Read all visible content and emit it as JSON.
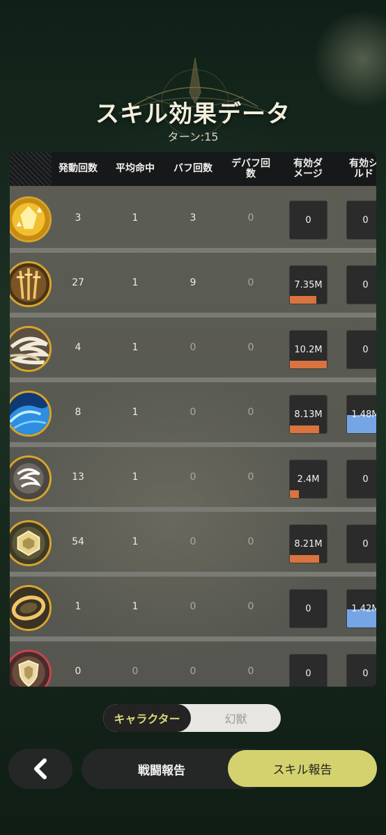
{
  "header": {
    "title": "スキル効果データ",
    "turn": "ターン:15"
  },
  "table": {
    "columns": [
      "発動回数",
      "平均命中",
      "バフ回数",
      "デバフ回\n数",
      "有効ダ\nメージ",
      "有効シ\nルド"
    ],
    "rows": [
      {
        "icon": "glowing-crystal-icon",
        "activations": "3",
        "avg_hit": "1",
        "buffs": "3",
        "debuffs": "0",
        "damage": "0",
        "damage_fill": 0,
        "shield": "0",
        "shield_fill": 0
      },
      {
        "icon": "triple-sword-icon",
        "activations": "27",
        "avg_hit": "1",
        "buffs": "9",
        "debuffs": "0",
        "damage": "7.35M",
        "damage_fill": 0.72,
        "shield": "0",
        "shield_fill": 0
      },
      {
        "icon": "whirlwind-icon",
        "activations": "4",
        "avg_hit": "1",
        "buffs": "0",
        "debuffs": "0",
        "damage": "10.2M",
        "damage_fill": 1.0,
        "shield": "0",
        "shield_fill": 0
      },
      {
        "icon": "water-wave-icon",
        "activations": "8",
        "avg_hit": "1",
        "buffs": "0",
        "debuffs": "0",
        "damage": "8.13M",
        "damage_fill": 0.8,
        "shield": "1.48M",
        "shield_fill": 1.0
      },
      {
        "icon": "white-tornado-icon",
        "activations": "13",
        "avg_hit": "1",
        "buffs": "0",
        "debuffs": "0",
        "damage": "2.4M",
        "damage_fill": 0.24,
        "shield": "0",
        "shield_fill": 0
      },
      {
        "icon": "hexagon-shield-icon",
        "activations": "54",
        "avg_hit": "1",
        "buffs": "0",
        "debuffs": "0",
        "damage": "8.21M",
        "damage_fill": 0.8,
        "shield": "0",
        "shield_fill": 0
      },
      {
        "icon": "golden-ring-icon",
        "activations": "1",
        "avg_hit": "1",
        "buffs": "0",
        "debuffs": "0",
        "damage": "0",
        "damage_fill": 0,
        "shield": "1.42M",
        "shield_fill": 0.96
      },
      {
        "icon": "crest-shield-icon",
        "activations": "0",
        "avg_hit": "0",
        "buffs": "0",
        "debuffs": "0",
        "damage": "0",
        "damage_fill": 0,
        "shield": "0",
        "shield_fill": 0
      }
    ]
  },
  "toggle": {
    "active": "キャラクター",
    "inactive": "幻獣"
  },
  "footer": {
    "battle_report": "戦闘報告",
    "skill_report": "スキル報告"
  },
  "colors": {
    "damage_bar": "#d9733f",
    "shield_bar": "#76a5e6",
    "accent_yellow": "#d3d26e"
  }
}
